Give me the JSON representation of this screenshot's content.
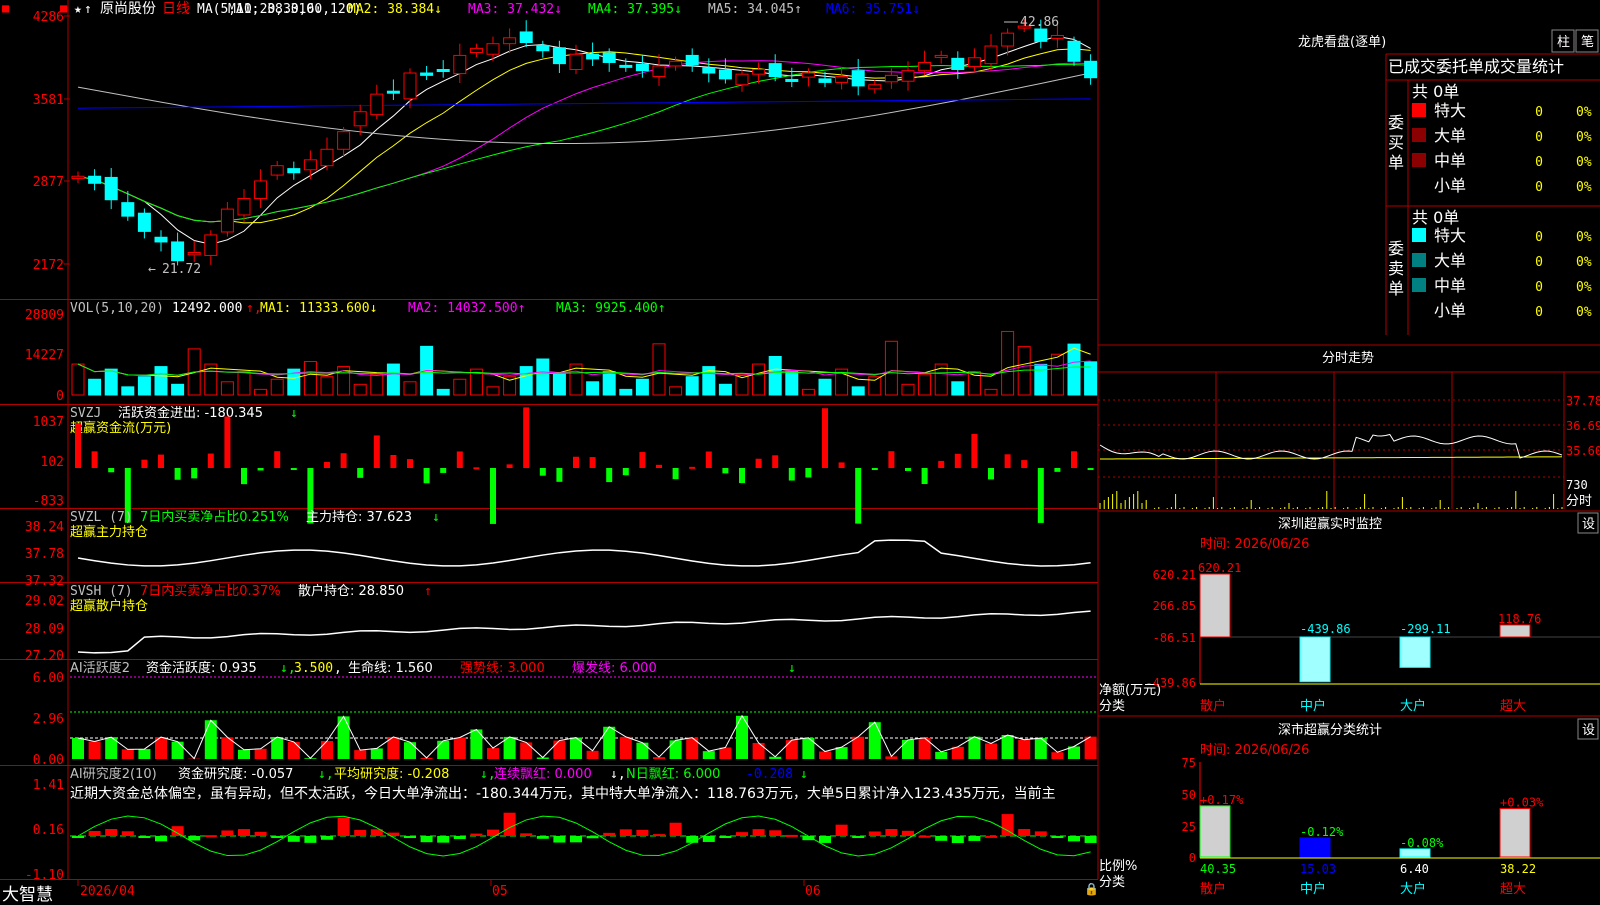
{
  "app": {
    "brand": "大智慧"
  },
  "header": {
    "stock_name": "原尚股份",
    "period": "日线",
    "ma_spec": "MA(5,10,20,30,60,120)",
    "ma_items": [
      {
        "label": "MA1: 38.310",
        "arrow": "↓",
        "color": "#ffffff"
      },
      {
        "label": "MA2: 38.384",
        "arrow": "↓",
        "color": "#ffff00"
      },
      {
        "label": "MA3: 37.432",
        "arrow": "↓",
        "color": "#ff00ff"
      },
      {
        "label": "MA4: 37.395",
        "arrow": "↓",
        "color": "#00ff00"
      },
      {
        "label": "MA5: 34.045",
        "arrow": "↑",
        "color": "#c0c0c0"
      },
      {
        "label": "MA6: 35.751",
        "arrow": "↓",
        "color": "#0000ff"
      }
    ],
    "price_axis": [
      "4286",
      "3581",
      "2877",
      "2172"
    ],
    "high_label": "42.86",
    "low_label": "21.72"
  },
  "vol_panel": {
    "title": "VOL(5,10,20)",
    "value": "12492.000",
    "items": [
      {
        "label": "MA1: 11333.600",
        "arrow": "↓",
        "color": "#ffff00"
      },
      {
        "label": "MA2: 14032.500",
        "arrow": "↑",
        "color": "#ff00ff"
      },
      {
        "label": "MA3: 9925.400",
        "arrow": "↑",
        "color": "#00ff00"
      }
    ],
    "axis": [
      "28809",
      "14227",
      "0"
    ]
  },
  "svzj_panel": {
    "title": "SVZJ",
    "label": "活跃资金进出: -180.345",
    "arrow": "↓",
    "subtitle": "超赢资金流(万元)",
    "axis": [
      "1037",
      "102",
      "-833"
    ]
  },
  "svzl_panel": {
    "title": "SVZL (7)",
    "green_text": "7日内买卖净占比0.251%",
    "label": "主力持仓: 37.623",
    "arrow": "↓",
    "subtitle": "超赢主力持仓",
    "axis": [
      "38.24",
      "37.78",
      "37.32"
    ]
  },
  "svsh_panel": {
    "title": "SVSH (7)",
    "red_text": "7日内买卖净占比0.37%",
    "label": "散户持仓: 28.850",
    "arrow": "↑",
    "subtitle": "超赢散户持仓",
    "axis": [
      "29.02",
      "28.09",
      "27.20"
    ]
  },
  "ai_active_panel": {
    "title": "AI活跃度2",
    "label1": "资金活跃度: 0.935",
    "label2": "3.500",
    "label3": "生命线: 1.560",
    "label4": "强势线: 3.000",
    "label5": "爆发线: 6.000",
    "axis": [
      "6.00",
      "2.96",
      "0.00"
    ]
  },
  "ai_research_panel": {
    "title": "AI研究度2(10)",
    "label1": "资金研究度: -0.057",
    "label2": "平均研究度: -0.208",
    "label3": "连续飘红: 0.000",
    "label4": "N日飘红: 6.000",
    "label5": "-0.208",
    "comment": "近期大资金总体偏空，虽有异动，但不太活跃，今日大单净流出：-180.344万元，其中特大单净流入：118.763万元，大单5日累计净入123.435万元，当前主",
    "axis": [
      "1.41",
      "0.16",
      "-1.10"
    ]
  },
  "date_axis": [
    "2026/04",
    "05",
    "06"
  ],
  "right_panel": {
    "dragon_tiger_title": "龙虎看盘(逐单)",
    "btn_bar": "柱",
    "btn_detail": "笔",
    "tab_header": "已成交委托单成交量统计",
    "buy_label": "委买单",
    "sell_label": "委卖单",
    "buy_total": "共 0单",
    "sell_total": "共 0单",
    "order_rows": [
      {
        "name": "特大",
        "count": "0",
        "pct": "0%"
      },
      {
        "name": "大单",
        "count": "0",
        "pct": "0%"
      },
      {
        "name": "中单",
        "count": "0",
        "pct": "0%"
      },
      {
        "name": "小单",
        "count": "0",
        "pct": "0%"
      }
    ],
    "intraday_title": "分时走势",
    "intraday_axis": [
      "37.78",
      "36.69",
      "35.60"
    ],
    "intraday_vol": "730",
    "intraday_footer": "分时",
    "sz_monitor_title": "深圳超赢实时监控",
    "sz_monitor_set": "设",
    "sz_time": "时间: 2026/06/26",
    "sz_axis": [
      "620.21",
      "266.85",
      "-86.51",
      "-439.86"
    ],
    "sz_bars": [
      {
        "cat": "散户",
        "value": 620.21,
        "label": "620.21"
      },
      {
        "cat": "中户",
        "value": -439.86,
        "label": "-439.86"
      },
      {
        "cat": "大户",
        "value": -299.11,
        "label": "-299.11"
      },
      {
        "cat": "超大",
        "value": 118.76,
        "label": "118.76"
      }
    ],
    "sz_ylabel": "净额(万元)",
    "sz_xlabel": "分类",
    "sz_class_title": "深市超赢分类统计",
    "sz_class_set": "设",
    "sz_class_time": "时间: 2026/06/26",
    "sz_class_axis": [
      "75",
      "50",
      "25",
      "0"
    ],
    "sz_class_bars": [
      {
        "cat": "散户",
        "value": 40.35,
        "label": "40.35",
        "chg": "+0.17%"
      },
      {
        "cat": "中户",
        "value": 15.03,
        "label": "15.03",
        "chg": "-0.12%"
      },
      {
        "cat": "大户",
        "value": 6.4,
        "label": "6.40",
        "chg": "-0.08%"
      },
      {
        "cat": "超大",
        "value": 38.22,
        "label": "38.22",
        "chg": "+0.03%"
      }
    ],
    "sz_class_ylabel": "比例%",
    "sz_class_xlabel": "分类"
  },
  "colors": {
    "up": "#ff0000",
    "down": "#00ffff",
    "grid": "#b00000"
  }
}
